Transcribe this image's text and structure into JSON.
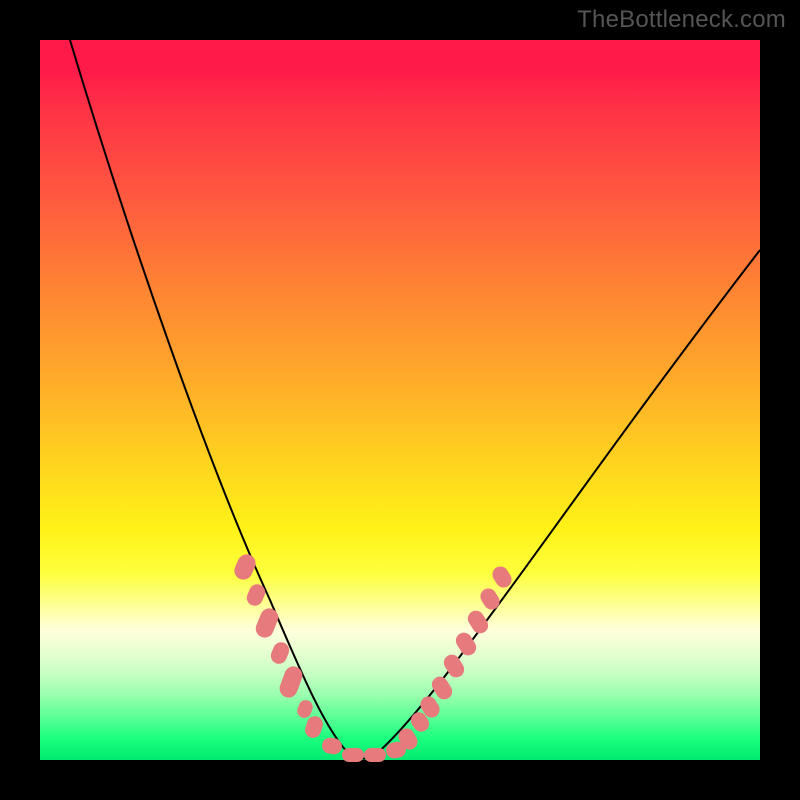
{
  "watermark": "TheBottleneck.com",
  "colors": {
    "frame": "#000000",
    "watermark": "#555555",
    "curve": "#000000",
    "marker": "#e67a7c"
  },
  "chart_data": {
    "type": "line",
    "title": "",
    "xlabel": "",
    "ylabel": "",
    "xlim": [
      0,
      100
    ],
    "ylim": [
      0,
      100
    ],
    "grid": false,
    "legend": false,
    "notes": "Vertical axis represents bottleneck percentage (high at top = red / bad, low at bottom = green / good). Horizontal axis is an unlabeled component-balance scale. Values estimated from pixel positions; no axis tick labels are shown in the image.",
    "series": [
      {
        "name": "bottleneck-curve",
        "x": [
          4,
          8,
          12,
          16,
          20,
          24,
          28,
          30,
          32,
          34,
          36,
          38,
          40,
          42,
          44,
          46,
          50,
          55,
          60,
          65,
          70,
          75,
          80,
          85,
          90,
          95,
          100
        ],
        "y": [
          100,
          91,
          82,
          73,
          64,
          55,
          44,
          38,
          31,
          24,
          17,
          10,
          4,
          1,
          0,
          1,
          4,
          10,
          17,
          24,
          31,
          38,
          45,
          52,
          59,
          65,
          71
        ]
      }
    ],
    "highlighted_points": {
      "name": "pink-dotted-segments",
      "description": "Thick pink dotted overlay on the lower part of both branches of the curve, roughly y ∈ [0, 28].",
      "left_branch": [
        {
          "x": 28,
          "y": 28
        },
        {
          "x": 30,
          "y": 24
        },
        {
          "x": 31,
          "y": 21
        },
        {
          "x": 32,
          "y": 18
        },
        {
          "x": 34,
          "y": 13
        },
        {
          "x": 35,
          "y": 10
        },
        {
          "x": 36,
          "y": 8
        },
        {
          "x": 37,
          "y": 6
        }
      ],
      "bottom": [
        {
          "x": 39,
          "y": 2
        },
        {
          "x": 41,
          "y": 0.5
        },
        {
          "x": 43,
          "y": 0
        },
        {
          "x": 45,
          "y": 0.5
        },
        {
          "x": 47,
          "y": 1.5
        }
      ],
      "right_branch": [
        {
          "x": 49,
          "y": 4
        },
        {
          "x": 50,
          "y": 6
        },
        {
          "x": 51,
          "y": 8
        },
        {
          "x": 52,
          "y": 10
        },
        {
          "x": 53,
          "y": 13
        },
        {
          "x": 54,
          "y": 15
        },
        {
          "x": 55,
          "y": 18
        },
        {
          "x": 56,
          "y": 21
        },
        {
          "x": 58,
          "y": 26
        }
      ]
    },
    "gradient_stops": [
      {
        "pct": 0,
        "color": "#ff1a49"
      },
      {
        "pct": 34,
        "color": "#ff8234"
      },
      {
        "pct": 68,
        "color": "#fff218"
      },
      {
        "pct": 100,
        "color": "#00e970"
      }
    ]
  }
}
